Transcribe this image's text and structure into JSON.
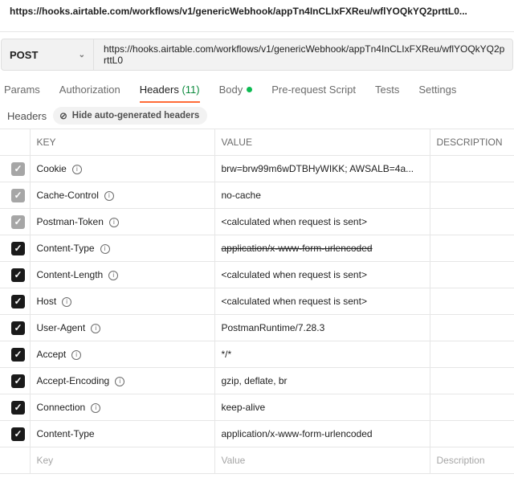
{
  "title": "https://hooks.airtable.com/workflows/v1/genericWebhook/appTn4InCLIxFXReu/wflYOQkYQ2prttL0...",
  "request": {
    "method": "POST",
    "url": "https://hooks.airtable.com/workflows/v1/genericWebhook/appTn4InCLIxFXReu/wflYOQkYQ2prttL0"
  },
  "tabs": [
    {
      "label": "Params"
    },
    {
      "label": "Authorization"
    },
    {
      "label": "Headers",
      "count": "(11)",
      "active": true
    },
    {
      "label": "Body",
      "dot": true
    },
    {
      "label": "Pre-request Script"
    },
    {
      "label": "Tests"
    },
    {
      "label": "Settings"
    }
  ],
  "headers_label": "Headers",
  "hide_button": "Hide auto-generated headers",
  "columns": {
    "key": "KEY",
    "value": "VALUE",
    "description": "DESCRIPTION"
  },
  "rows": [
    {
      "key": "Cookie",
      "value": "brw=brw99m6wDTBHyWIKK; AWSALB=4a...",
      "state": "disabled",
      "info": true
    },
    {
      "key": "Cache-Control",
      "value": "no-cache",
      "state": "disabled",
      "info": true
    },
    {
      "key": "Postman-Token",
      "value": "<calculated when request is sent>",
      "state": "disabled",
      "info": true
    },
    {
      "key": "Content-Type",
      "value": "application/x-www-form-urlencoded",
      "state": "checked",
      "info": true,
      "strike": true
    },
    {
      "key": "Content-Length",
      "value": "<calculated when request is sent>",
      "state": "checked",
      "info": true
    },
    {
      "key": "Host",
      "value": "<calculated when request is sent>",
      "state": "checked",
      "info": true
    },
    {
      "key": "User-Agent",
      "value": "PostmanRuntime/7.28.3",
      "state": "checked",
      "info": true
    },
    {
      "key": "Accept",
      "value": "*/*",
      "state": "checked",
      "info": true
    },
    {
      "key": "Accept-Encoding",
      "value": "gzip, deflate, br",
      "state": "checked",
      "info": true
    },
    {
      "key": "Connection",
      "value": "keep-alive",
      "state": "checked",
      "info": true
    },
    {
      "key": "Content-Type",
      "value": "application/x-www-form-urlencoded",
      "state": "checked",
      "info": false
    }
  ],
  "placeholders": {
    "key": "Key",
    "value": "Value",
    "description": "Description"
  }
}
